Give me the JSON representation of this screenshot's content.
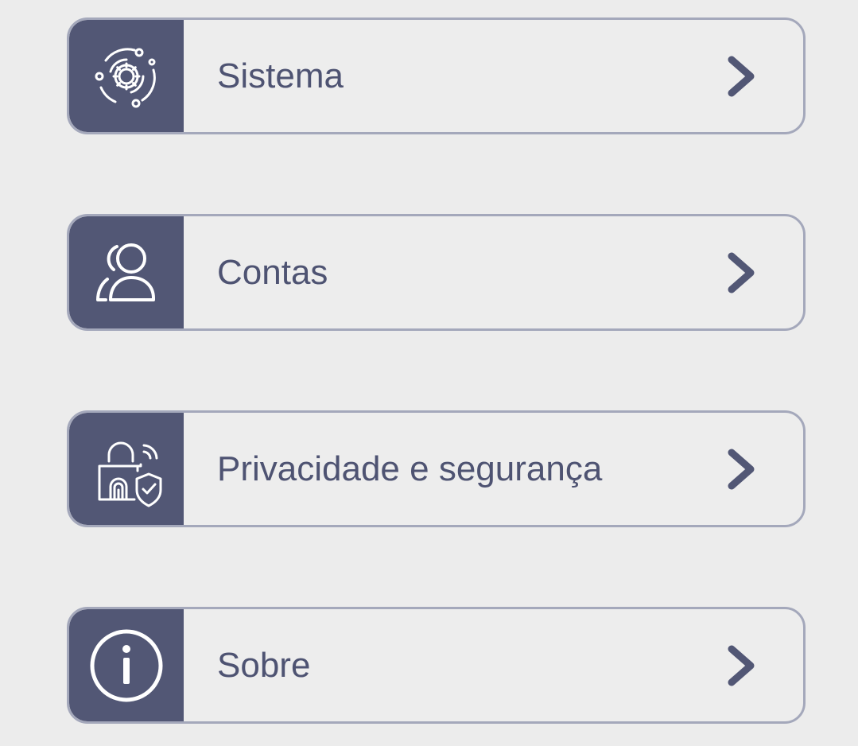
{
  "colors": {
    "background": "#ececec",
    "icon_tile": "#525775",
    "text": "#4e5372",
    "border": "#a4a8bb"
  },
  "menu": {
    "items": [
      {
        "label": "Sistema",
        "icon": "system-gear-icon"
      },
      {
        "label": "Contas",
        "icon": "accounts-users-icon"
      },
      {
        "label": "Privacidade e segurança",
        "icon": "privacy-lock-shield-icon"
      },
      {
        "label": "Sobre",
        "icon": "info-icon"
      }
    ],
    "chevron_icon": "chevron-right-icon"
  }
}
